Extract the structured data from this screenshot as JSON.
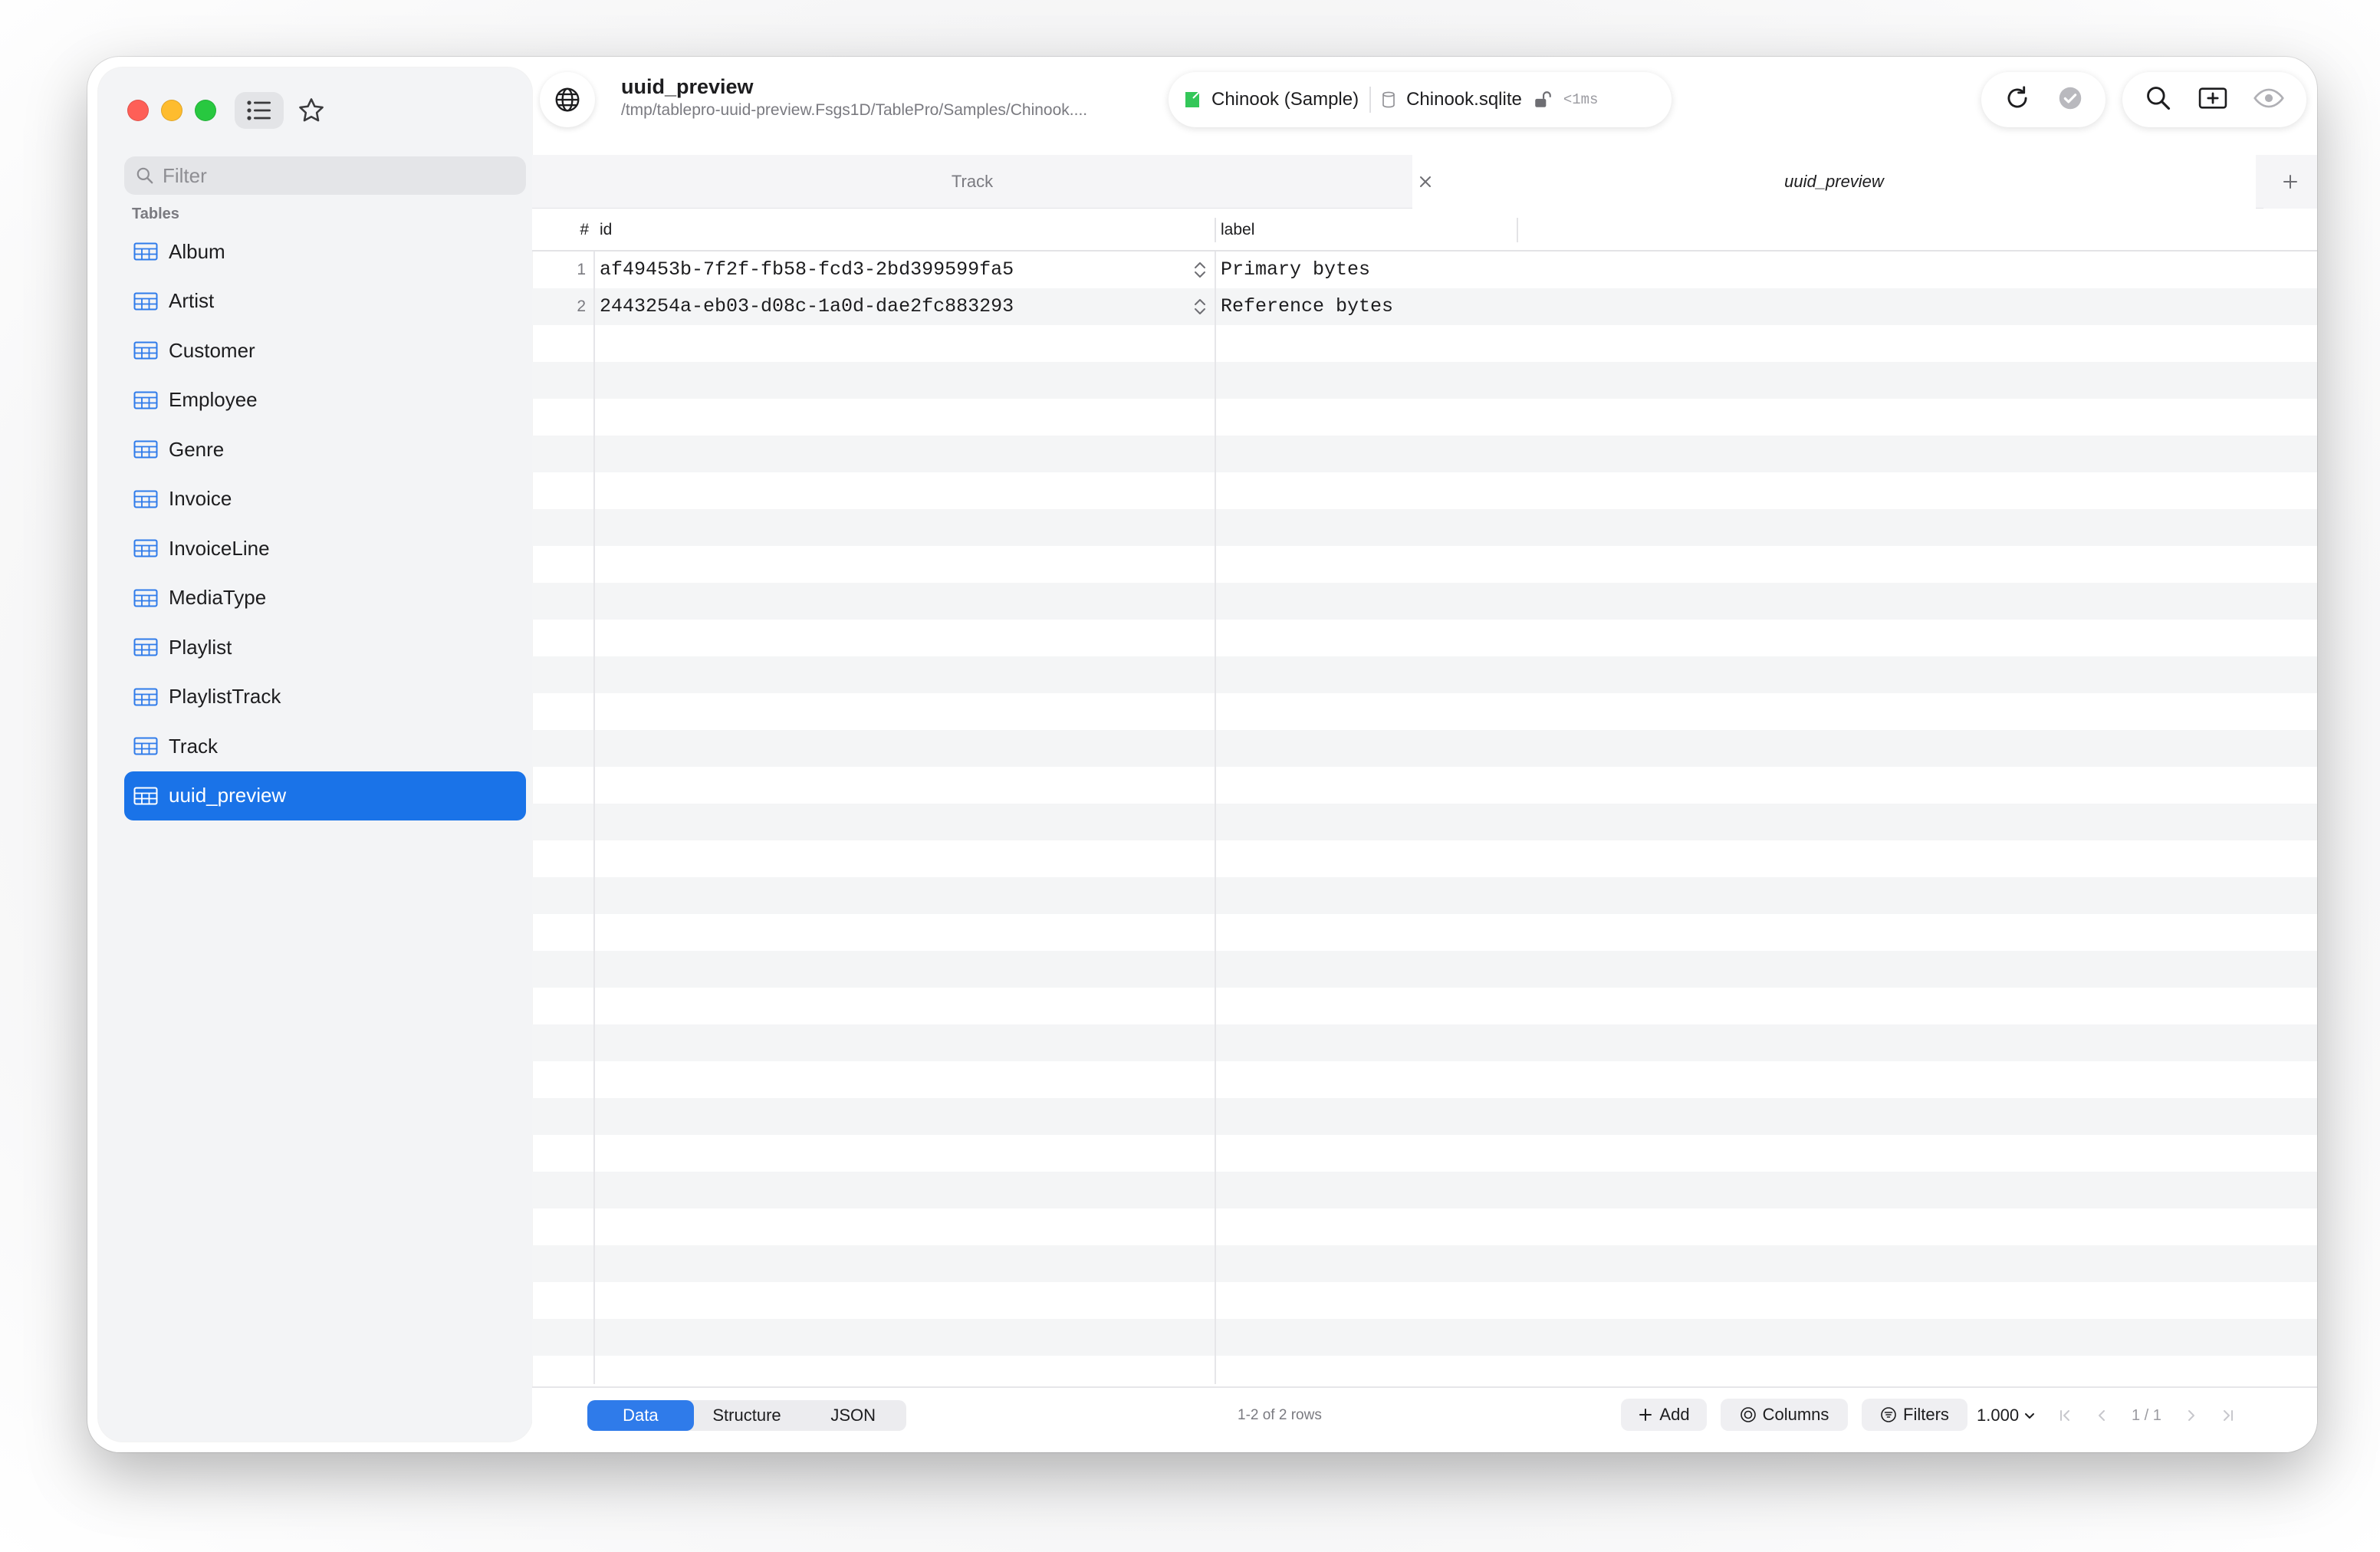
{
  "window": {
    "title": "uuid_preview",
    "path": "/tmp/tablepro-uuid-preview.Fsgs1D/TablePro/Samples/Chinook...."
  },
  "connection": {
    "name": "Chinook (Sample)",
    "database": "Chinook.sqlite",
    "latency": "<1ms",
    "accent_color": "#34c759"
  },
  "sidebar": {
    "filter_placeholder": "Filter",
    "section_title": "Tables",
    "items": [
      {
        "label": "Album"
      },
      {
        "label": "Artist"
      },
      {
        "label": "Customer"
      },
      {
        "label": "Employee"
      },
      {
        "label": "Genre"
      },
      {
        "label": "Invoice"
      },
      {
        "label": "InvoiceLine"
      },
      {
        "label": "MediaType"
      },
      {
        "label": "Playlist"
      },
      {
        "label": "PlaylistTrack"
      },
      {
        "label": "Track"
      },
      {
        "label": "uuid_preview",
        "selected": true
      }
    ],
    "selected_color": "#1a73e8"
  },
  "tabs": [
    {
      "label": "Track"
    },
    {
      "label": "uuid_preview",
      "active": true
    }
  ],
  "grid": {
    "row_number_header": "#",
    "columns": [
      "id",
      "label"
    ],
    "rows": [
      {
        "num": "1",
        "id": "af49453b-7f2f-fb58-fcd3-2bd399599fa5",
        "label": "Primary bytes"
      },
      {
        "num": "2",
        "id": "2443254a-eb03-d08c-1a0d-dae2fc883293",
        "label": "Reference bytes"
      }
    ]
  },
  "bottombar": {
    "views": [
      "Data",
      "Structure",
      "JSON"
    ],
    "active_view": "Data",
    "row_count": "1-2 of 2 rows",
    "add_label": "Add",
    "columns_label": "Columns",
    "filters_label": "Filters",
    "limit": "1.000",
    "page": "1 / 1"
  },
  "icons": [
    "globe-icon",
    "list-icon",
    "star-icon",
    "search-icon",
    "table-icon",
    "refresh-icon",
    "checkmark-icon",
    "add-row-icon",
    "eye-icon",
    "sidebar-toggle-icon",
    "close-icon",
    "plus-icon",
    "stepper-icon",
    "lock-icon",
    "database-icon",
    "columns-icon",
    "filter-icon",
    "chevron-down-icon",
    "first-page-icon",
    "prev-page-icon",
    "next-page-icon",
    "last-page-icon"
  ]
}
